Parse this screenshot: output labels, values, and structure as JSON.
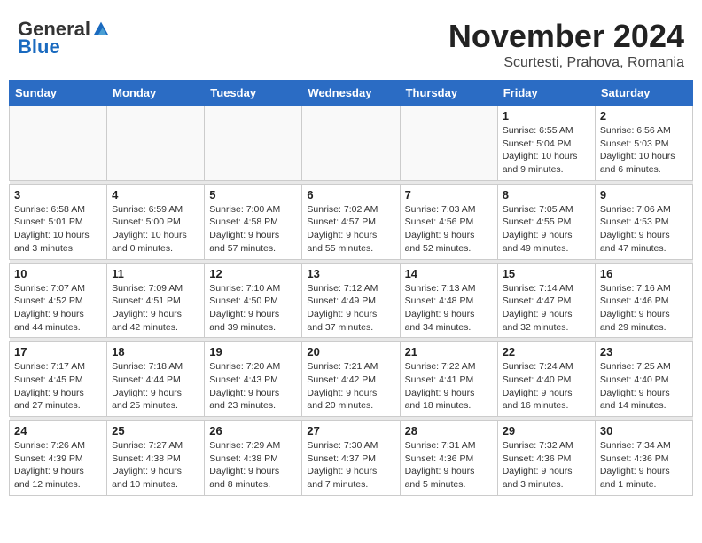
{
  "header": {
    "logo_general": "General",
    "logo_blue": "Blue",
    "month_title": "November 2024",
    "location": "Scurtesti, Prahova, Romania"
  },
  "days_of_week": [
    "Sunday",
    "Monday",
    "Tuesday",
    "Wednesday",
    "Thursday",
    "Friday",
    "Saturday"
  ],
  "weeks": [
    {
      "days": [
        {
          "num": "",
          "info": ""
        },
        {
          "num": "",
          "info": ""
        },
        {
          "num": "",
          "info": ""
        },
        {
          "num": "",
          "info": ""
        },
        {
          "num": "",
          "info": ""
        },
        {
          "num": "1",
          "info": "Sunrise: 6:55 AM\nSunset: 5:04 PM\nDaylight: 10 hours and 9 minutes."
        },
        {
          "num": "2",
          "info": "Sunrise: 6:56 AM\nSunset: 5:03 PM\nDaylight: 10 hours and 6 minutes."
        }
      ]
    },
    {
      "days": [
        {
          "num": "3",
          "info": "Sunrise: 6:58 AM\nSunset: 5:01 PM\nDaylight: 10 hours and 3 minutes."
        },
        {
          "num": "4",
          "info": "Sunrise: 6:59 AM\nSunset: 5:00 PM\nDaylight: 10 hours and 0 minutes."
        },
        {
          "num": "5",
          "info": "Sunrise: 7:00 AM\nSunset: 4:58 PM\nDaylight: 9 hours and 57 minutes."
        },
        {
          "num": "6",
          "info": "Sunrise: 7:02 AM\nSunset: 4:57 PM\nDaylight: 9 hours and 55 minutes."
        },
        {
          "num": "7",
          "info": "Sunrise: 7:03 AM\nSunset: 4:56 PM\nDaylight: 9 hours and 52 minutes."
        },
        {
          "num": "8",
          "info": "Sunrise: 7:05 AM\nSunset: 4:55 PM\nDaylight: 9 hours and 49 minutes."
        },
        {
          "num": "9",
          "info": "Sunrise: 7:06 AM\nSunset: 4:53 PM\nDaylight: 9 hours and 47 minutes."
        }
      ]
    },
    {
      "days": [
        {
          "num": "10",
          "info": "Sunrise: 7:07 AM\nSunset: 4:52 PM\nDaylight: 9 hours and 44 minutes."
        },
        {
          "num": "11",
          "info": "Sunrise: 7:09 AM\nSunset: 4:51 PM\nDaylight: 9 hours and 42 minutes."
        },
        {
          "num": "12",
          "info": "Sunrise: 7:10 AM\nSunset: 4:50 PM\nDaylight: 9 hours and 39 minutes."
        },
        {
          "num": "13",
          "info": "Sunrise: 7:12 AM\nSunset: 4:49 PM\nDaylight: 9 hours and 37 minutes."
        },
        {
          "num": "14",
          "info": "Sunrise: 7:13 AM\nSunset: 4:48 PM\nDaylight: 9 hours and 34 minutes."
        },
        {
          "num": "15",
          "info": "Sunrise: 7:14 AM\nSunset: 4:47 PM\nDaylight: 9 hours and 32 minutes."
        },
        {
          "num": "16",
          "info": "Sunrise: 7:16 AM\nSunset: 4:46 PM\nDaylight: 9 hours and 29 minutes."
        }
      ]
    },
    {
      "days": [
        {
          "num": "17",
          "info": "Sunrise: 7:17 AM\nSunset: 4:45 PM\nDaylight: 9 hours and 27 minutes."
        },
        {
          "num": "18",
          "info": "Sunrise: 7:18 AM\nSunset: 4:44 PM\nDaylight: 9 hours and 25 minutes."
        },
        {
          "num": "19",
          "info": "Sunrise: 7:20 AM\nSunset: 4:43 PM\nDaylight: 9 hours and 23 minutes."
        },
        {
          "num": "20",
          "info": "Sunrise: 7:21 AM\nSunset: 4:42 PM\nDaylight: 9 hours and 20 minutes."
        },
        {
          "num": "21",
          "info": "Sunrise: 7:22 AM\nSunset: 4:41 PM\nDaylight: 9 hours and 18 minutes."
        },
        {
          "num": "22",
          "info": "Sunrise: 7:24 AM\nSunset: 4:40 PM\nDaylight: 9 hours and 16 minutes."
        },
        {
          "num": "23",
          "info": "Sunrise: 7:25 AM\nSunset: 4:40 PM\nDaylight: 9 hours and 14 minutes."
        }
      ]
    },
    {
      "days": [
        {
          "num": "24",
          "info": "Sunrise: 7:26 AM\nSunset: 4:39 PM\nDaylight: 9 hours and 12 minutes."
        },
        {
          "num": "25",
          "info": "Sunrise: 7:27 AM\nSunset: 4:38 PM\nDaylight: 9 hours and 10 minutes."
        },
        {
          "num": "26",
          "info": "Sunrise: 7:29 AM\nSunset: 4:38 PM\nDaylight: 9 hours and 8 minutes."
        },
        {
          "num": "27",
          "info": "Sunrise: 7:30 AM\nSunset: 4:37 PM\nDaylight: 9 hours and 7 minutes."
        },
        {
          "num": "28",
          "info": "Sunrise: 7:31 AM\nSunset: 4:36 PM\nDaylight: 9 hours and 5 minutes."
        },
        {
          "num": "29",
          "info": "Sunrise: 7:32 AM\nSunset: 4:36 PM\nDaylight: 9 hours and 3 minutes."
        },
        {
          "num": "30",
          "info": "Sunrise: 7:34 AM\nSunset: 4:36 PM\nDaylight: 9 hours and 1 minute."
        }
      ]
    }
  ]
}
